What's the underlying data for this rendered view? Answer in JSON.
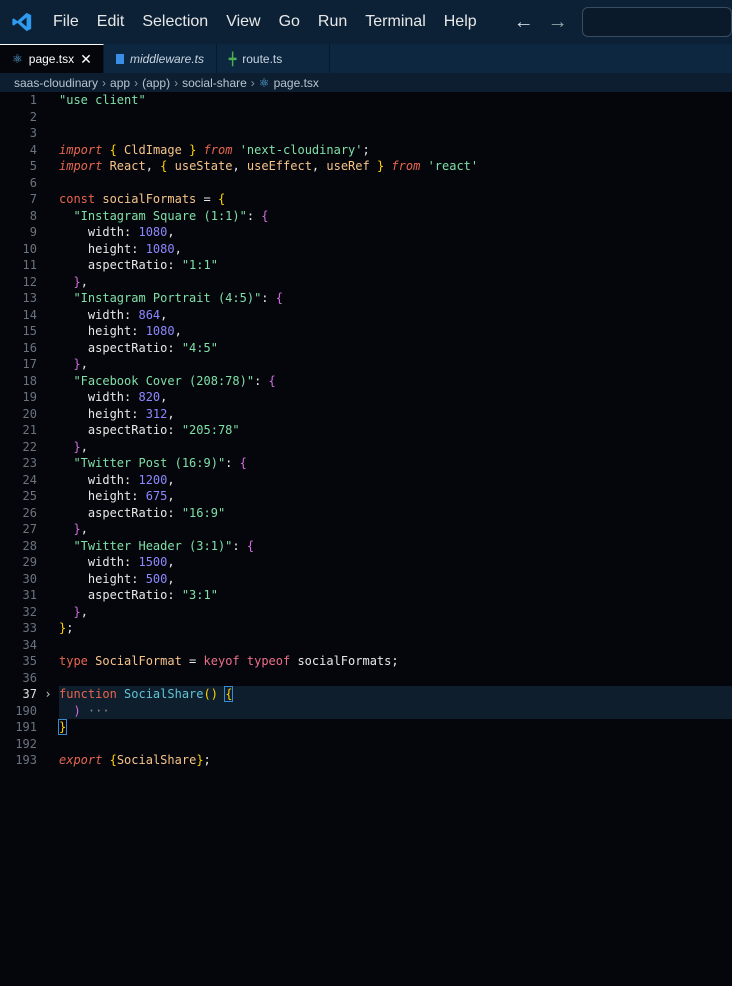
{
  "menu": [
    "File",
    "Edit",
    "Selection",
    "View",
    "Go",
    "Run",
    "Terminal",
    "Help"
  ],
  "tabs": [
    {
      "label": "page.tsx",
      "icon": "react-icon"
    },
    {
      "label": "middleware.ts",
      "icon": "ts-icon"
    },
    {
      "label": "route.ts",
      "icon": "route-icon"
    }
  ],
  "breadcrumbs": [
    "saas-cloudinary",
    "app",
    "(app)",
    "social-share",
    "page.tsx"
  ],
  "colors": {
    "accent": "#0c2136",
    "bg": "#05060b"
  },
  "lines": [
    {
      "n": "1",
      "t": [
        [
          "str",
          "\"use client\""
        ]
      ]
    },
    {
      "n": "2",
      "t": []
    },
    {
      "n": "3",
      "t": []
    },
    {
      "n": "4",
      "t": [
        [
          "imp",
          "import"
        ],
        [
          "pl",
          " "
        ],
        [
          "b1",
          "{"
        ],
        [
          "id",
          " CldImage "
        ],
        [
          "b1",
          "}"
        ],
        [
          "pl",
          " "
        ],
        [
          "imp",
          "from"
        ],
        [
          "pl",
          " "
        ],
        [
          "str",
          "'next-cloudinary'"
        ],
        [
          "pl",
          ";"
        ]
      ]
    },
    {
      "n": "5",
      "t": [
        [
          "imp",
          "import"
        ],
        [
          "id",
          " React"
        ],
        [
          "pl",
          ", "
        ],
        [
          "b1",
          "{"
        ],
        [
          "id",
          " useState"
        ],
        [
          "pl",
          ", "
        ],
        [
          "id",
          "useEffect"
        ],
        [
          "pl",
          ", "
        ],
        [
          "id",
          "useRef "
        ],
        [
          "b1",
          "}"
        ],
        [
          "pl",
          " "
        ],
        [
          "imp",
          "from"
        ],
        [
          "pl",
          " "
        ],
        [
          "str",
          "'react'"
        ]
      ]
    },
    {
      "n": "6",
      "t": []
    },
    {
      "n": "7",
      "t": [
        [
          "kw",
          "const"
        ],
        [
          "id",
          " socialFormats"
        ],
        [
          "pl",
          " = "
        ],
        [
          "b1",
          "{"
        ]
      ]
    },
    {
      "n": "8",
      "t": [
        [
          "pl",
          "  "
        ],
        [
          "str",
          "\"Instagram Square (1:1)\""
        ],
        [
          "pl",
          ": "
        ],
        [
          "b2",
          "{"
        ]
      ]
    },
    {
      "n": "9",
      "t": [
        [
          "prop",
          "    width: "
        ],
        [
          "num",
          "1080"
        ],
        [
          "pl",
          ","
        ]
      ]
    },
    {
      "n": "10",
      "t": [
        [
          "prop",
          "    height: "
        ],
        [
          "num",
          "1080"
        ],
        [
          "pl",
          ","
        ]
      ]
    },
    {
      "n": "11",
      "t": [
        [
          "prop",
          "    aspectRatio: "
        ],
        [
          "str",
          "\"1:1\""
        ]
      ]
    },
    {
      "n": "12",
      "t": [
        [
          "pl",
          "  "
        ],
        [
          "b2",
          "}"
        ],
        [
          "pl",
          ","
        ]
      ]
    },
    {
      "n": "13",
      "t": [
        [
          "pl",
          "  "
        ],
        [
          "str",
          "\"Instagram Portrait (4:5)\""
        ],
        [
          "pl",
          ": "
        ],
        [
          "b2",
          "{"
        ]
      ]
    },
    {
      "n": "14",
      "t": [
        [
          "prop",
          "    width: "
        ],
        [
          "num",
          "864"
        ],
        [
          "pl",
          ","
        ]
      ]
    },
    {
      "n": "15",
      "t": [
        [
          "prop",
          "    height: "
        ],
        [
          "num",
          "1080"
        ],
        [
          "pl",
          ","
        ]
      ]
    },
    {
      "n": "16",
      "t": [
        [
          "prop",
          "    aspectRatio: "
        ],
        [
          "str",
          "\"4:5\""
        ]
      ]
    },
    {
      "n": "17",
      "t": [
        [
          "pl",
          "  "
        ],
        [
          "b2",
          "}"
        ],
        [
          "pl",
          ","
        ]
      ]
    },
    {
      "n": "18",
      "t": [
        [
          "pl",
          "  "
        ],
        [
          "str",
          "\"Facebook Cover (208:78)\""
        ],
        [
          "pl",
          ": "
        ],
        [
          "b2",
          "{"
        ]
      ]
    },
    {
      "n": "19",
      "t": [
        [
          "prop",
          "    width: "
        ],
        [
          "num",
          "820"
        ],
        [
          "pl",
          ","
        ]
      ]
    },
    {
      "n": "20",
      "t": [
        [
          "prop",
          "    height: "
        ],
        [
          "num",
          "312"
        ],
        [
          "pl",
          ","
        ]
      ]
    },
    {
      "n": "21",
      "t": [
        [
          "prop",
          "    aspectRatio: "
        ],
        [
          "str",
          "\"205:78\""
        ]
      ]
    },
    {
      "n": "22",
      "t": [
        [
          "pl",
          "  "
        ],
        [
          "b2",
          "}"
        ],
        [
          "pl",
          ","
        ]
      ]
    },
    {
      "n": "23",
      "t": [
        [
          "pl",
          "  "
        ],
        [
          "str",
          "\"Twitter Post (16:9)\""
        ],
        [
          "pl",
          ": "
        ],
        [
          "b2",
          "{"
        ]
      ]
    },
    {
      "n": "24",
      "t": [
        [
          "prop",
          "    width: "
        ],
        [
          "num",
          "1200"
        ],
        [
          "pl",
          ","
        ]
      ]
    },
    {
      "n": "25",
      "t": [
        [
          "prop",
          "    height: "
        ],
        [
          "num",
          "675"
        ],
        [
          "pl",
          ","
        ]
      ]
    },
    {
      "n": "26",
      "t": [
        [
          "prop",
          "    aspectRatio: "
        ],
        [
          "str",
          "\"16:9\""
        ]
      ]
    },
    {
      "n": "27",
      "t": [
        [
          "pl",
          "  "
        ],
        [
          "b2",
          "}"
        ],
        [
          "pl",
          ","
        ]
      ]
    },
    {
      "n": "28",
      "t": [
        [
          "pl",
          "  "
        ],
        [
          "str",
          "\"Twitter Header (3:1)\""
        ],
        [
          "pl",
          ": "
        ],
        [
          "b2",
          "{"
        ]
      ]
    },
    {
      "n": "29",
      "t": [
        [
          "prop",
          "    width: "
        ],
        [
          "num",
          "1500"
        ],
        [
          "pl",
          ","
        ]
      ]
    },
    {
      "n": "30",
      "t": [
        [
          "prop",
          "    height: "
        ],
        [
          "num",
          "500"
        ],
        [
          "pl",
          ","
        ]
      ]
    },
    {
      "n": "31",
      "t": [
        [
          "prop",
          "    aspectRatio: "
        ],
        [
          "str",
          "\"3:1\""
        ]
      ]
    },
    {
      "n": "32",
      "t": [
        [
          "pl",
          "  "
        ],
        [
          "b2",
          "}"
        ],
        [
          "pl",
          ","
        ]
      ]
    },
    {
      "n": "33",
      "t": [
        [
          "b1",
          "}"
        ],
        [
          "pl",
          ";"
        ]
      ]
    },
    {
      "n": "34",
      "t": []
    },
    {
      "n": "35",
      "t": [
        [
          "kw",
          "type"
        ],
        [
          "id",
          " SocialFormat"
        ],
        [
          "pl",
          " = "
        ],
        [
          "ty",
          "keyof typeof"
        ],
        [
          "pl",
          " socialFormats;"
        ]
      ]
    },
    {
      "n": "36",
      "t": []
    },
    {
      "n": "37",
      "cur": true,
      "fold": true,
      "hl": true,
      "t": [
        [
          "kw",
          "function"
        ],
        [
          "pl",
          " "
        ],
        [
          "fn",
          "SocialShare"
        ],
        [
          "b1",
          "()"
        ],
        [
          "pl",
          " "
        ],
        [
          "b1 bm",
          "{"
        ]
      ]
    },
    {
      "n": "190",
      "hl": true,
      "t": [
        [
          "pl",
          "  "
        ],
        [
          "b2",
          ")"
        ],
        [
          "ell",
          " ···"
        ]
      ]
    },
    {
      "n": "191",
      "t": [
        [
          "b1 bm",
          "}"
        ]
      ]
    },
    {
      "n": "192",
      "t": []
    },
    {
      "n": "193",
      "t": [
        [
          "imp",
          "export"
        ],
        [
          "pl",
          " "
        ],
        [
          "b1",
          "{"
        ],
        [
          "id",
          "SocialShare"
        ],
        [
          "b1",
          "}"
        ],
        [
          "pl",
          ";"
        ]
      ]
    }
  ]
}
